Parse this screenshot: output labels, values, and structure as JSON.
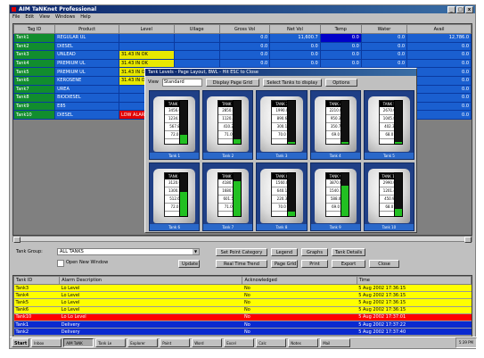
{
  "window": {
    "title": "AIM TaNKnet Professional",
    "min": "_",
    "max": "□",
    "close": "x"
  },
  "menu": [
    "File",
    "Edit",
    "View",
    "Windows",
    "Help"
  ],
  "tags_table": {
    "headers": [
      "Tag ID",
      "Product",
      "Level",
      "Ullage",
      "Gross Vol",
      "Net Vol",
      "Temp",
      "Water",
      "Avail"
    ],
    "rows": [
      {
        "tag": "Tank1",
        "product": "REGULAR UL",
        "level": "",
        "ullage": "",
        "gross": "0.0",
        "net": "11,600.7",
        "temp": "0.0",
        "water": "0.0",
        "avail": "12,786.0"
      },
      {
        "tag": "Tank2",
        "product": "DIESEL",
        "level": "",
        "ullage": "",
        "gross": "0.0",
        "net": "0.0",
        "temp": "0.0",
        "water": "0.0",
        "avail": "0.0"
      },
      {
        "tag": "Tank3",
        "product": "UNLEAD",
        "level": "31.43 IN OK",
        "ullage": "",
        "gross": "0.0",
        "net": "0.0",
        "temp": "0.0",
        "water": "0.0",
        "avail": "0.0"
      },
      {
        "tag": "Tank4",
        "product": "PREMIUM UL",
        "level": "31.43 IN OK",
        "ullage": "",
        "gross": "0.0",
        "net": "0.0",
        "temp": "0.0",
        "water": "0.0",
        "avail": "0.0"
      },
      {
        "tag": "Tank5",
        "product": "PREMIUM UL",
        "level": "31.43 IN OK",
        "ullage": "",
        "gross": "0.0",
        "net": "0.0",
        "temp": "0.0",
        "water": "0.0",
        "avail": "0.0"
      },
      {
        "tag": "Tank6",
        "product": "KEROSENE",
        "level": "31.43 IN OK",
        "ullage": "",
        "gross": "0.0",
        "net": "0.0",
        "temp": "0.0",
        "water": "0.0",
        "avail": "0.0"
      },
      {
        "tag": "Tank7",
        "product": "UREA",
        "level": "",
        "ullage": "",
        "gross": "0.0",
        "net": "0.0",
        "temp": "0.0",
        "water": "0.0",
        "avail": "0.0"
      },
      {
        "tag": "Tank8",
        "product": "BIODIESEL",
        "level": "",
        "ullage": "",
        "gross": "0.0",
        "net": "0.0",
        "temp": "0.0",
        "water": "0.0",
        "avail": "0.0"
      },
      {
        "tag": "Tank9",
        "product": "E85",
        "level": "",
        "ullage": "",
        "gross": "0.0",
        "net": "0.0",
        "temp": "0.0",
        "water": "0.0",
        "avail": "0.0"
      },
      {
        "tag": "Tank10",
        "product": "DIESEL",
        "level": "LOW ALARM",
        "ullage": "",
        "gross": "0.0",
        "net": "0.0",
        "temp": "0.0",
        "water": "0.0",
        "avail": "0.0"
      }
    ]
  },
  "dialog": {
    "title": "Tank Levels - Page Layout, BWL - Hit ESC to Close",
    "view_label": "View",
    "view_value": "Standard",
    "buttons": [
      "Display Page Grid",
      "Select Tanks to display",
      "Options"
    ],
    "tanks": [
      {
        "label": "Tank 1",
        "top": "TANK 1",
        "vals": [
          "3456.0",
          "1234.5",
          "567.8",
          "72.0"
        ],
        "level": 0.2
      },
      {
        "label": "Tank 2",
        "top": "TANK 2",
        "vals": [
          "2850.0",
          "1120.4",
          "410.2",
          "71.0"
        ],
        "level": 0.1
      },
      {
        "label": "Tank 3",
        "top": "TANK 3",
        "vals": [
          "1990.0",
          "890.6",
          "300.1",
          "70.0"
        ],
        "level": 0.05
      },
      {
        "label": "Tank 4",
        "top": "TANK 4",
        "vals": [
          "2210.0",
          "950.3",
          "350.7",
          "69.0"
        ],
        "level": 0.05
      },
      {
        "label": "Tank 5",
        "top": "TANK 5",
        "vals": [
          "2670.0",
          "1045.8",
          "402.3",
          "68.0"
        ],
        "level": 0.05
      },
      {
        "label": "Tank 6",
        "top": "TANK 6",
        "vals": [
          "3120.0",
          "1300.2",
          "512.6",
          "72.0"
        ],
        "level": 0.55
      },
      {
        "label": "Tank 7",
        "top": "TANK 7",
        "vals": [
          "4180.0",
          "1680.9",
          "601.5",
          "71.0"
        ],
        "level": 0.8
      },
      {
        "label": "Tank 8",
        "top": "TANK 8",
        "vals": [
          "1560.0",
          "640.1",
          "220.3",
          "70.0"
        ],
        "level": 0.1
      },
      {
        "label": "Tank 9",
        "top": "TANK 9",
        "vals": [
          "3870.0",
          "1540.7",
          "588.0",
          "69.0"
        ],
        "level": 0.7
      },
      {
        "label": "Tank 10",
        "top": "TANK 10",
        "vals": [
          "2990.0",
          "1201.4",
          "450.9",
          "68.0"
        ],
        "level": 0.15
      }
    ]
  },
  "controls": {
    "tank_group_label": "Tank Group:",
    "tank_group_value": "ALL TANKS",
    "open_new_window": "Open New Window",
    "update_btn": "Update",
    "buttons": [
      "Set Point Category",
      "Legend",
      "Graphs",
      "Tank Details",
      "Real Time Trend",
      "Page Grid",
      "Print",
      "Export",
      "Close"
    ]
  },
  "events": {
    "headers": [
      "Tank ID",
      "Alarm Description",
      "Acknowledged",
      "Time"
    ],
    "rows": [
      {
        "id": "Tank3",
        "desc": "Lo Level",
        "ack": "No",
        "time": "5 Aug 2002 17:36:15",
        "bg": "#ffff00",
        "fg": "#000000"
      },
      {
        "id": "Tank4",
        "desc": "Lo Level",
        "ack": "No",
        "time": "5 Aug 2002 17:36:15",
        "bg": "#ffff00",
        "fg": "#000000"
      },
      {
        "id": "Tank5",
        "desc": "Lo Level",
        "ack": "No",
        "time": "5 Aug 2002 17:36:15",
        "bg": "#ffff00",
        "fg": "#000000"
      },
      {
        "id": "Tank6",
        "desc": "Lo Level",
        "ack": "No",
        "time": "5 Aug 2002 17:36:15",
        "bg": "#ffff00",
        "fg": "#000000"
      },
      {
        "id": "Tank10",
        "desc": "Lo Lo Level",
        "ack": "No",
        "time": "5 Aug 2002 17:37:01",
        "bg": "#ff0000",
        "fg": "#ffffff"
      },
      {
        "id": "Tank1",
        "desc": "Delivery",
        "ack": "No",
        "time": "5 Aug 2002 17:37:22",
        "bg": "#0a2ad0",
        "fg": "#ffffff"
      },
      {
        "id": "Tank2",
        "desc": "Delivery",
        "ack": "No",
        "time": "5 Aug 2002 17:37:40",
        "bg": "#0a2ad0",
        "fg": "#ffffff"
      }
    ]
  },
  "taskbar": {
    "start": "Start",
    "items": [
      "Inbox",
      "AIM TaNK",
      "Tank Le",
      "Explorer",
      "Paint",
      "Word",
      "Excel",
      "Calc",
      "Notes",
      "Mail"
    ],
    "clock": "5:39 PM"
  },
  "colors": {
    "accent": "#0a246a",
    "grid_blue": "#1a5fd0",
    "tag_green": "#118d2e",
    "alarm_red": "#e00000",
    "warn_yellow": "#e8e800"
  }
}
